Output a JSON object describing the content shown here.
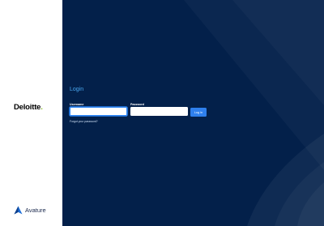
{
  "brand": {
    "client_name": "Deloitte",
    "client_dot": ".",
    "vendor_name": "Avature"
  },
  "login": {
    "title": "Login",
    "username_label": "Username",
    "username_value": "",
    "password_label": "Password",
    "password_value": "",
    "submit_label": "Log in",
    "forgot_label": "Forgot your password?"
  },
  "colors": {
    "background": "#03204a",
    "accent": "#2f80ed",
    "title": "#4aa8f0",
    "brand_dot": "#86bc25"
  },
  "icons": {
    "vendor": "avature-logo-icon"
  }
}
